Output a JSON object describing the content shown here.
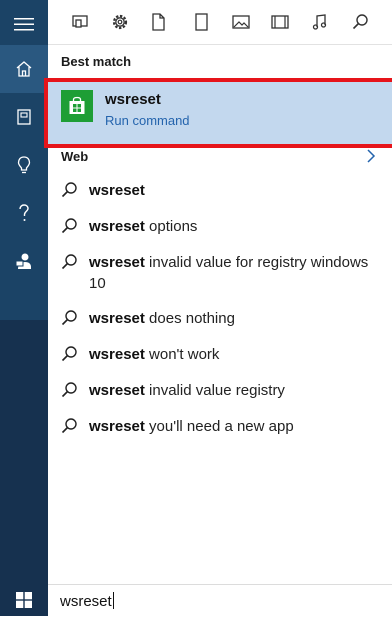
{
  "rail": {
    "items": [
      {
        "name": "home",
        "icon": "home-icon",
        "active": true
      },
      {
        "name": "notebook",
        "icon": "notebook-icon",
        "active": false
      },
      {
        "name": "tips",
        "icon": "lightbulb-icon",
        "active": false
      },
      {
        "name": "help",
        "icon": "question-icon",
        "active": false
      },
      {
        "name": "feedback",
        "icon": "feedback-icon",
        "active": false
      }
    ]
  },
  "filters": [
    {
      "name": "apps",
      "icon": "apps-icon"
    },
    {
      "name": "settings",
      "icon": "gear-icon"
    },
    {
      "name": "documents",
      "icon": "document-icon"
    },
    {
      "name": "folders",
      "icon": "tablet-icon"
    },
    {
      "name": "photos",
      "icon": "photo-icon"
    },
    {
      "name": "videos",
      "icon": "video-icon"
    },
    {
      "name": "music",
      "icon": "music-icon"
    },
    {
      "name": "web",
      "icon": "search-icon"
    }
  ],
  "best_match": {
    "heading": "Best match",
    "name": "wsreset",
    "kind": "Run command",
    "icon": "store-icon",
    "highlight_color": "#e6141a",
    "tile_color": "#1e9e35"
  },
  "web": {
    "heading": "Web",
    "suggestions": [
      {
        "bold": "wsreset",
        "rest": ""
      },
      {
        "bold": "wsreset",
        "rest": " options"
      },
      {
        "bold": "wsreset",
        "rest": " invalid value for registry windows 10"
      },
      {
        "bold": "wsreset",
        "rest": " does nothing"
      },
      {
        "bold": "wsreset",
        "rest": " won't work"
      },
      {
        "bold": "wsreset",
        "rest": " invalid value registry"
      },
      {
        "bold": "wsreset",
        "rest": " you'll need a new app"
      }
    ]
  },
  "search": {
    "value": "wsreset"
  },
  "colors": {
    "rail": "#1b4366",
    "accent_text": "#2464ad",
    "selection": "#c3d8ee"
  }
}
